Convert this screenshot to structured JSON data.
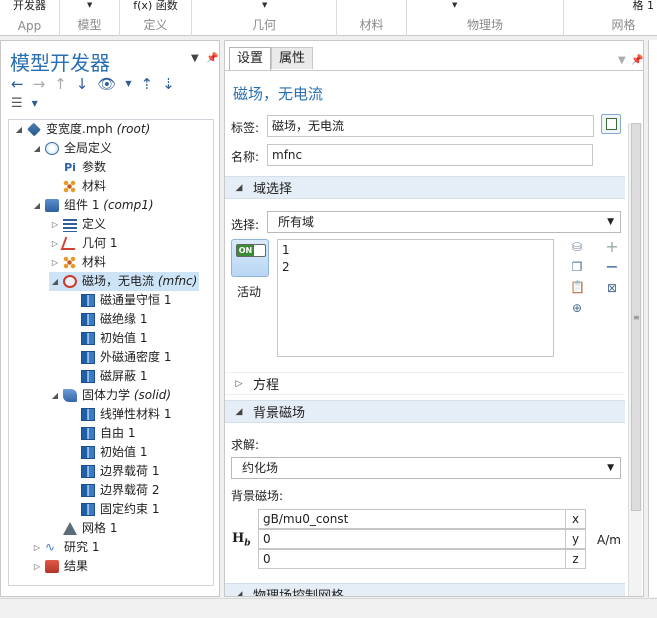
{
  "ribbon": {
    "sections": [
      {
        "top": "开发器",
        "label": "App"
      },
      {
        "top": "",
        "label": "模型"
      },
      {
        "top": "f(x) 函数",
        "label": "定义"
      },
      {
        "top": "",
        "label": "几何"
      },
      {
        "top": "",
        "label": "材料"
      },
      {
        "top": "",
        "label": "物理场"
      },
      {
        "top": "格 1",
        "label": "网格"
      }
    ]
  },
  "model_builder": {
    "title": "模型开发器",
    "tree": [
      {
        "label": "变宽度.mph",
        "italic": "(root)"
      },
      {
        "label": "全局定义",
        "italic": ""
      },
      {
        "label": "参数",
        "italic": "",
        "prefix": "Pi"
      },
      {
        "label": "材料",
        "italic": ""
      },
      {
        "label": "组件 1",
        "italic": "(comp1)"
      },
      {
        "label": "定义",
        "italic": ""
      },
      {
        "label": "几何 1",
        "italic": ""
      },
      {
        "label": "材料",
        "italic": ""
      },
      {
        "label": "磁场，无电流",
        "italic": "(mfnc)"
      },
      {
        "label": "磁通量守恒 1",
        "italic": ""
      },
      {
        "label": "磁绝缘 1",
        "italic": ""
      },
      {
        "label": "初始值 1",
        "italic": ""
      },
      {
        "label": "外磁通密度 1",
        "italic": ""
      },
      {
        "label": "磁屏蔽 1",
        "italic": ""
      },
      {
        "label": "固体力学",
        "italic": "(solid)"
      },
      {
        "label": "线弹性材料 1",
        "italic": ""
      },
      {
        "label": "自由 1",
        "italic": ""
      },
      {
        "label": "初始值 1",
        "italic": ""
      },
      {
        "label": "边界载荷 1",
        "italic": ""
      },
      {
        "label": "边界载荷 2",
        "italic": ""
      },
      {
        "label": "固定约束 1",
        "italic": ""
      },
      {
        "label": "网格 1",
        "italic": ""
      },
      {
        "label": "研究 1",
        "italic": ""
      },
      {
        "label": "结果",
        "italic": ""
      }
    ]
  },
  "settings": {
    "tabs": [
      "设置",
      "属性"
    ],
    "title": "磁场，无电流",
    "label_caption": "标签:",
    "label_value": "磁场，无电流",
    "name_caption": "名称:",
    "name_value": "mfnc",
    "domain_section": "域选择",
    "selection_caption": "选择:",
    "selection_value": "所有域",
    "toggle_text": "ON",
    "active_caption": "活动",
    "domains": [
      "1",
      "2"
    ],
    "equation_section": "方程",
    "bg_section": "背景磁场",
    "solve_caption": "求解:",
    "solve_value": "约化场",
    "bg_field_caption": "背景磁场:",
    "vector_symbol": "H",
    "vector_sub": "b",
    "vector": [
      {
        "value": "gB/mu0_const",
        "comp": "x"
      },
      {
        "value": "0",
        "comp": "y"
      },
      {
        "value": "0",
        "comp": "z"
      }
    ],
    "unit": "A/m",
    "next_section": "物理场控制网格"
  }
}
